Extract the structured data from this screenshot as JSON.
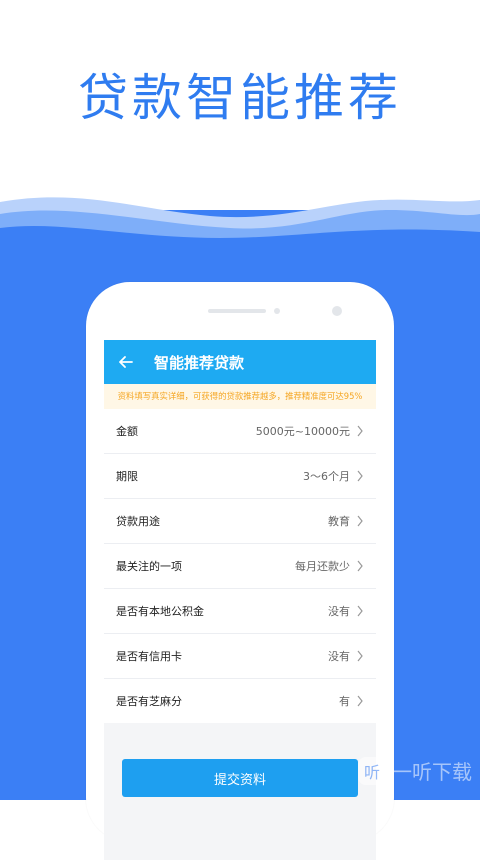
{
  "headline": "贷款智能推荐",
  "app": {
    "title": "智能推荐贷款",
    "notice": "资料填写真实详细，可获得的贷款推荐越多，推荐精准度可达95%",
    "rows": [
      {
        "label": "金额",
        "value": "5000元~10000元"
      },
      {
        "label": "期限",
        "value": "3〜6个月"
      },
      {
        "label": "贷款用途",
        "value": "教育"
      },
      {
        "label": "最关注的一项",
        "value": "每月还款少"
      },
      {
        "label": "是否有本地公积金",
        "value": "没有"
      },
      {
        "label": "是否有信用卡",
        "value": "没有"
      },
      {
        "label": "是否有芝麻分",
        "value": "有"
      }
    ],
    "submit_label": "提交资料"
  },
  "watermark": {
    "logo": "听",
    "text": "一听下载"
  },
  "colors": {
    "headline": "#2f7cf0",
    "background_blue": "#3b7ff5",
    "appbar": "#1eaaf2",
    "notice_text": "#f5a623",
    "notice_bg": "#fff7e6",
    "button": "#1e9ff0"
  },
  "icons": {
    "back": "arrow-left-icon",
    "row_chevron": "chevron-right-icon"
  }
}
